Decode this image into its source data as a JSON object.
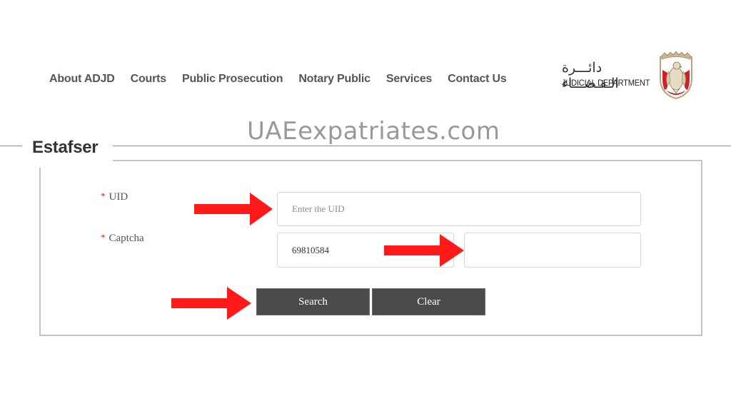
{
  "nav": {
    "items": [
      {
        "label": "About ADJD"
      },
      {
        "label": "Courts"
      },
      {
        "label": "Public Prosecution"
      },
      {
        "label": "Notary Public"
      },
      {
        "label": "Services"
      },
      {
        "label": "Contact Us"
      }
    ]
  },
  "logo": {
    "arabic_text": "دائـــرة الـقـضـــاء",
    "english_text": "JUDICIAL DEPARTMENT",
    "emblem_icon": "abu-dhabi-falcon-emblem",
    "colors": {
      "red": "#d11f2a",
      "gold": "#b8a27a"
    }
  },
  "watermark": "UAEexpatriates.com",
  "section": {
    "title": "Estafser"
  },
  "form": {
    "uid": {
      "required_marker": "*",
      "label": "UID",
      "placeholder": "Enter the UID",
      "value": ""
    },
    "captcha": {
      "required_marker": "*",
      "label": "Captcha",
      "code": "69810584",
      "input_value": ""
    },
    "buttons": {
      "search_label": "Search",
      "clear_label": "Clear"
    }
  },
  "annotations": {
    "arrow_color": "#ff1a1a",
    "arrows": [
      "points-to-uid-input",
      "points-to-captcha-input",
      "points-to-search-button"
    ]
  }
}
